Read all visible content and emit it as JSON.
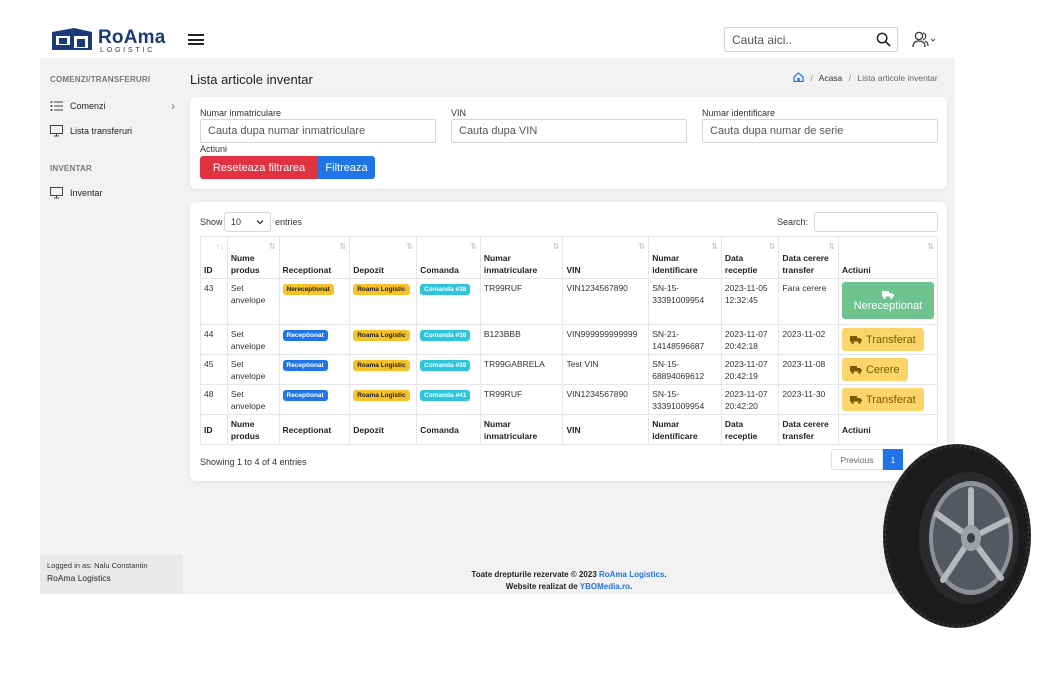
{
  "app": {
    "brand": "RoAma",
    "brand_sub": "LOGISTIC",
    "search_placeholder": "Cauta aici.."
  },
  "sidebar": {
    "section1": "COMENZI/TRANSFERURI",
    "item_comenzi": "Comenzi",
    "item_transferuri": "Lista transferuri",
    "section2": "INVENTAR",
    "item_inventar": "Inventar",
    "logged_in": "Logged in as: Nalu Constantin",
    "company": "RoAma Logistics"
  },
  "page": {
    "title": "Lista articole inventar",
    "breadcrumb_home": "Acasa",
    "breadcrumb_current": "Lista articole inventar"
  },
  "filters": {
    "nr_inmatriculare_label": "Numar inmatriculare",
    "nr_inmatriculare_placeholder": "Cauta dupa numar inmatriculare",
    "vin_label": "VIN",
    "vin_placeholder": "Cauta dupa VIN",
    "nr_identificare_label": "Numar identificare",
    "nr_identificare_placeholder": "Cauta dupa numar de serie",
    "actions_label": "Actiuni",
    "reset_label": "Reseteaza filtrarea",
    "filter_label": "Filtreaza"
  },
  "table": {
    "show_label": "Show",
    "entries_value": "10",
    "entries_label": "entries",
    "search_label": "Search:",
    "columns": [
      "ID",
      "Nume produs",
      "Receptionat",
      "Depozit",
      "Comanda",
      "Numar inmatriculare",
      "VIN",
      "Numar identificare",
      "Data receptie",
      "Data cerere transfer",
      "Actiuni"
    ],
    "rows": [
      {
        "id": "43",
        "product": "Set anvelope",
        "status": "Nereceptionat",
        "depot": "Roama Logistic",
        "order": "Comanda #38",
        "plate": "TR99RUF",
        "vin": "VIN1234567890",
        "serial": "SN-15-33391009954",
        "received": "2023-11-05 12:32:45",
        "transfer": "Fara cerere",
        "action": "Nereceptionat"
      },
      {
        "id": "44",
        "product": "Set anvelope",
        "status": "Receptionat",
        "depot": "Roama Logistic",
        "order": "Comanda #38",
        "plate": "B123BBB",
        "vin": "VIN999999999999",
        "serial": "SN-21-14148596687",
        "received": "2023-11-07 20:42:18",
        "transfer": "2023-11-02",
        "action": "Transferat"
      },
      {
        "id": "45",
        "product": "Set anvelope",
        "status": "Receptionat",
        "depot": "Roama Logistic",
        "order": "Comanda #39",
        "plate": "TR99GABRELA",
        "vin": "Test VIN",
        "serial": "SN-15-68894069612",
        "received": "2023-11-07 20:42:19",
        "transfer": "2023-11-08",
        "action": "Cerere"
      },
      {
        "id": "48",
        "product": "Set anvelope",
        "status": "Receptionat",
        "depot": "Roama Logistic",
        "order": "Comanda #41",
        "plate": "TR99RUF",
        "vin": "VIN1234567890",
        "serial": "SN-15-33391009954",
        "received": "2023-11-07 20:42:20",
        "transfer": "2023-11-30",
        "action": "Transferat"
      }
    ],
    "showing": "Showing 1 to 4 of 4 entries",
    "prev_label": "Previous",
    "page_1": "1"
  },
  "footer": {
    "rights_prefix": "Toate drepturile rezervate © 2023",
    "rights_company": "RoAma Logistics",
    "made_prefix": "Website realizat de",
    "made_company": "YBOMedia.ro"
  },
  "colors": {
    "brand": "#1b3a7a",
    "danger": "#e0323f",
    "primary": "#1f74e8",
    "warning": "#f5c227",
    "info": "#2ec4dc",
    "success": "#6ec38f"
  },
  "icons": [
    "search-icon",
    "user-icon",
    "list-icon",
    "monitor-icon",
    "home-icon",
    "truck-icon",
    "chevron-right-icon",
    "sort-icon"
  ]
}
